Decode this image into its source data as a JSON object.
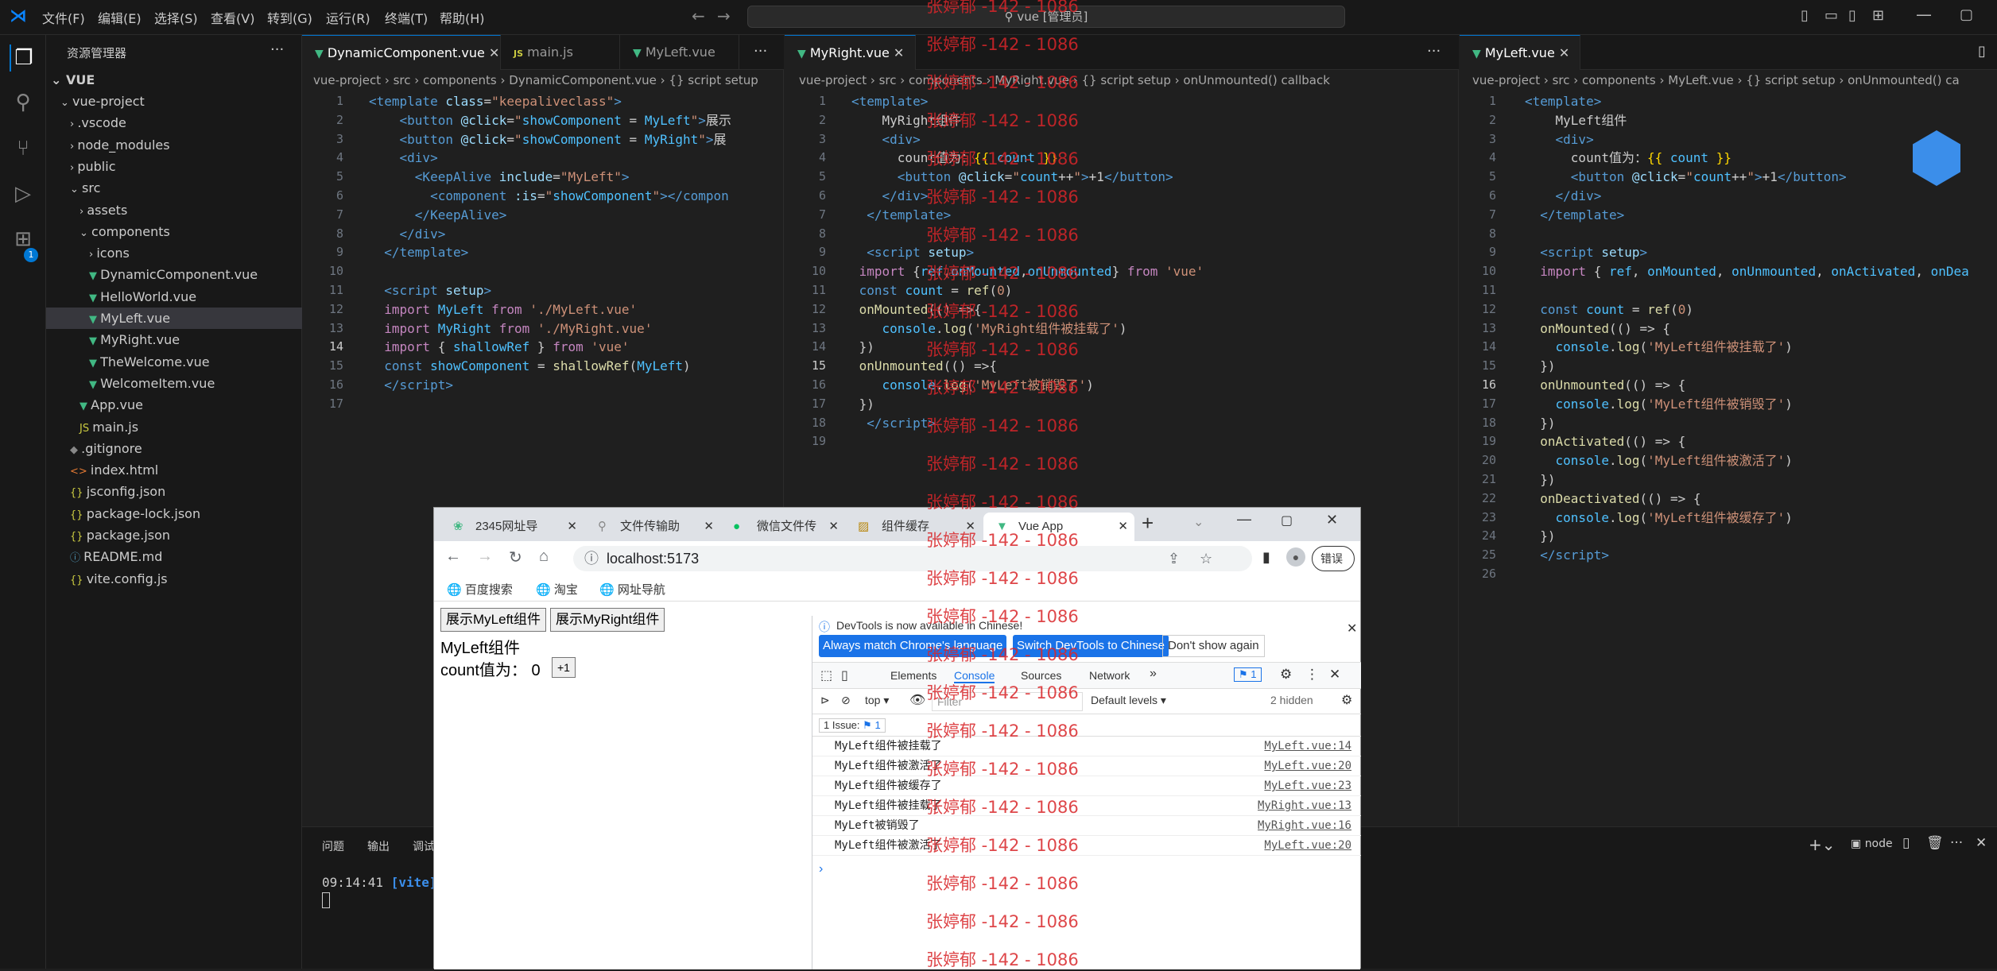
{
  "titlebar": {
    "menus": [
      "文件(F)",
      "编辑(E)",
      "选择(S)",
      "查看(V)",
      "转到(G)",
      "运行(R)",
      "终端(T)",
      "帮助(H)"
    ],
    "search": "vue [管理员]"
  },
  "sidebar": {
    "title": "资源管理器",
    "root": "VUE",
    "items": [
      "vue-project",
      ".vscode",
      "node_modules",
      "public",
      "src",
      "assets",
      "components",
      "icons",
      "DynamicComponent.vue",
      "HelloWorld.vue",
      "MyLeft.vue",
      "MyRight.vue",
      "TheWelcome.vue",
      "WelcomeItem.vue",
      "App.vue",
      "main.js",
      ".gitignore",
      "index.html",
      "jsconfig.json",
      "package-lock.json",
      "package.json",
      "README.md",
      "vite.config.js"
    ]
  },
  "editor1": {
    "tabs": [
      "DynamicComponent.vue",
      "main.js",
      "MyLeft.vue"
    ],
    "breadcrumb": "vue-project › src › components › DynamicComponent.vue › {} script setup",
    "lines": [
      "1",
      "2",
      "3",
      "4",
      "5",
      "6",
      "7",
      "8",
      "9",
      "10",
      "11",
      "12",
      "13",
      "14",
      "15",
      "16",
      "17"
    ]
  },
  "editor2": {
    "tab": "MyRight.vue",
    "breadcrumb": "vue-project › src › components › MyRight.vue › {} script setup › onUnmounted() callback",
    "lines": [
      "1",
      "2",
      "3",
      "4",
      "5",
      "6",
      "7",
      "8",
      "9",
      "10",
      "11",
      "12",
      "13",
      "14",
      "15",
      "16",
      "17",
      "18",
      "19"
    ]
  },
  "editor3": {
    "tab": "MyLeft.vue",
    "breadcrumb": "vue-project › src › components › MyLeft.vue › {} script setup › onUnmounted() ca",
    "lines": [
      "1",
      "2",
      "3",
      "4",
      "5",
      "6",
      "7",
      "8",
      "9",
      "10",
      "11",
      "12",
      "13",
      "14",
      "15",
      "16",
      "17",
      "18",
      "19",
      "20",
      "21",
      "22",
      "23",
      "24",
      "25",
      "26"
    ]
  },
  "panel": {
    "tabs": [
      "问题",
      "输出",
      "调试"
    ],
    "terminal_time": "09:14:41",
    "terminal_tag": "[vite]",
    "right_label": "node"
  },
  "browser": {
    "tabs": [
      "2345网址导",
      "文件传输助",
      "微信文件传",
      "组件缓存",
      "Vue App"
    ],
    "url": "localhost:5173",
    "error_btn": "错误",
    "bookmarks": [
      "百度搜索",
      "淘宝",
      "网址导航"
    ],
    "page": {
      "btn_left": "展示MyLeft组件",
      "btn_right": "展示MyRight组件",
      "comp_name": "MyLeft组件",
      "count_label": "count值为：",
      "count_value": "0",
      "plus": "+1"
    },
    "devtools": {
      "notice": "DevTools is now available in Chinese!",
      "btn_match": "Always match Chrome's language",
      "btn_switch": "Switch DevTools to Chinese",
      "btn_dont": "Don't show again",
      "tabs": [
        "Elements",
        "Console",
        "Sources",
        "Network"
      ],
      "issue_badge": "1",
      "context": "top",
      "filter_placeholder": "Filter",
      "levels": "Default levels",
      "hidden": "2 hidden",
      "issues": "1 Issue:",
      "issues_count": "1",
      "logs": [
        {
          "msg": "MyLeft组件被挂载了",
          "src": "MyLeft.vue:14"
        },
        {
          "msg": "MyLeft组件被激活了",
          "src": "MyLeft.vue:20"
        },
        {
          "msg": "MyLeft组件被缓存了",
          "src": "MyLeft.vue:23"
        },
        {
          "msg": "MyLeft组件被挂载了",
          "src": "MyRight.vue:13"
        },
        {
          "msg": "MyLeft被销毁了",
          "src": "MyRight.vue:16"
        },
        {
          "msg": "MyLeft组件被激活了",
          "src": "MyLeft.vue:20"
        }
      ]
    }
  },
  "watermark": "张婷郁 -142 - 1086",
  "colors": {
    "accent": "#0078d4",
    "vue_green": "#41b883",
    "watermark": "#d9262a"
  }
}
